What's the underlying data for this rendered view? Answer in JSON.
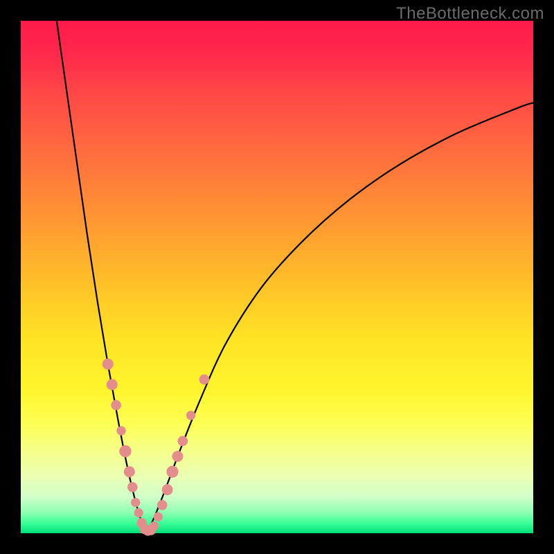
{
  "watermark": "TheBottleneck.com",
  "chart_data": {
    "type": "line",
    "title": "",
    "xlabel": "",
    "ylabel": "",
    "xlim": [
      0,
      100
    ],
    "ylim": [
      0,
      100
    ],
    "grid": false,
    "legend": false,
    "note": "Axes are unlabeled; values are relative percentages estimated from pixel positions (0=left/bottom, 100=right/top).",
    "series": [
      {
        "name": "left-branch",
        "x": [
          7,
          9,
          11,
          13,
          15,
          17,
          19,
          21,
          23,
          24.5
        ],
        "y": [
          100,
          86,
          72,
          58,
          45,
          33,
          22,
          12,
          4,
          0
        ]
      },
      {
        "name": "right-branch",
        "x": [
          24.5,
          26,
          28,
          31,
          35,
          40,
          47,
          55,
          64,
          74,
          85,
          97,
          100
        ],
        "y": [
          0,
          3,
          8,
          16,
          26,
          37,
          48,
          57,
          65,
          72,
          78,
          83,
          84
        ]
      }
    ],
    "markers": {
      "name": "highlight-points",
      "color": "#e38d8d",
      "points": [
        {
          "x": 17.0,
          "y": 33,
          "r": 1.2
        },
        {
          "x": 17.8,
          "y": 29,
          "r": 1.2
        },
        {
          "x": 18.6,
          "y": 25,
          "r": 1.1
        },
        {
          "x": 19.6,
          "y": 20,
          "r": 1.0
        },
        {
          "x": 20.4,
          "y": 16,
          "r": 1.3
        },
        {
          "x": 21.2,
          "y": 12,
          "r": 1.2
        },
        {
          "x": 21.8,
          "y": 9,
          "r": 1.1
        },
        {
          "x": 22.4,
          "y": 6,
          "r": 1.0
        },
        {
          "x": 23.0,
          "y": 4,
          "r": 1.0
        },
        {
          "x": 23.6,
          "y": 2,
          "r": 1.1
        },
        {
          "x": 24.2,
          "y": 0.8,
          "r": 1.1
        },
        {
          "x": 24.8,
          "y": 0.5,
          "r": 1.1
        },
        {
          "x": 25.4,
          "y": 0.6,
          "r": 1.1
        },
        {
          "x": 26.0,
          "y": 1.4,
          "r": 1.0
        },
        {
          "x": 26.8,
          "y": 3.2,
          "r": 1.0
        },
        {
          "x": 27.6,
          "y": 5.5,
          "r": 1.1
        },
        {
          "x": 28.6,
          "y": 8.5,
          "r": 1.2
        },
        {
          "x": 29.6,
          "y": 12,
          "r": 1.3
        },
        {
          "x": 30.6,
          "y": 15,
          "r": 1.2
        },
        {
          "x": 31.6,
          "y": 18,
          "r": 1.1
        },
        {
          "x": 33.2,
          "y": 23,
          "r": 1.0
        },
        {
          "x": 35.8,
          "y": 30,
          "r": 1.1
        }
      ]
    }
  }
}
